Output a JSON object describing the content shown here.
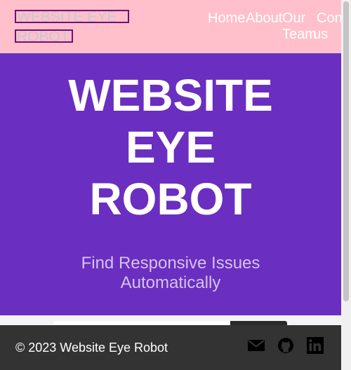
{
  "header": {
    "logo_line1": "WEBSITE EYE",
    "logo_line2": "ROBOT",
    "nav": {
      "home": "Home",
      "about": "About",
      "our": "Our",
      "team": "Team",
      "contact_partial": "Con",
      "us": "us"
    }
  },
  "hero": {
    "title_line1": "WEBSITE",
    "title_line2": "EYE",
    "title_line3": "ROBOT",
    "subtitle_line1": "Find Responsive Issues",
    "subtitle_line2": "Automatically"
  },
  "footer": {
    "copyright": "© 2023 Website Eye Robot",
    "icons": [
      "mail-icon",
      "github-icon",
      "linkedin-icon"
    ]
  },
  "colors": {
    "header_bg": "#ffc0cb",
    "hero_bg": "#6a2ec0",
    "footer_bg": "#333333",
    "logo_border": "#7a0a78"
  }
}
